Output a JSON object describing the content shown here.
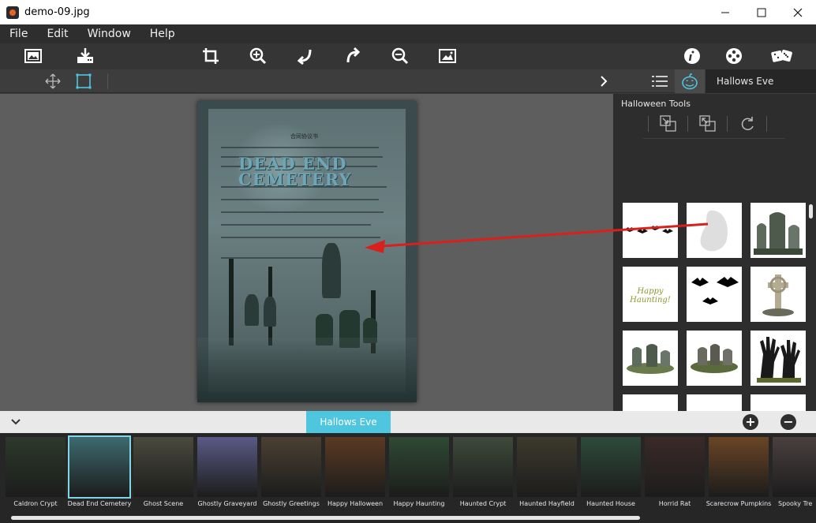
{
  "window": {
    "title": "demo-09.jpg",
    "minimize": "—",
    "maximize": "☐",
    "close": "✕"
  },
  "menu": {
    "items": [
      "File",
      "Edit",
      "Window",
      "Help"
    ]
  },
  "toolbar": {
    "left_icons": [
      "open-image-icon",
      "save-icon"
    ],
    "center_icons": [
      "crop-icon",
      "zoom-in-icon",
      "undo-icon",
      "redo-icon",
      "zoom-out-icon",
      "fit-image-icon"
    ],
    "right_icons": [
      "info-icon",
      "film-reel-icon",
      "dice-icon"
    ]
  },
  "subbar": {
    "icons": [
      "move-icon",
      "select-rect-icon"
    ],
    "expand_icon": "chevron-right-icon",
    "panel_tabs": [
      "list-icon",
      "pumpkin-icon"
    ],
    "panel_title": "Hallows Eve"
  },
  "document": {
    "title": "合同协议书",
    "overlay_text_line1": "DEAD END",
    "overlay_text_line2": "CEMETERY"
  },
  "right_panel": {
    "title": "Halloween Tools",
    "tools": [
      "bring-forward-icon",
      "send-backward-icon",
      "rotate-icon"
    ],
    "thumbnails": [
      {
        "name": "bats-line",
        "caption": ""
      },
      {
        "name": "ghost",
        "caption": ""
      },
      {
        "name": "tombstones",
        "caption": ""
      },
      {
        "name": "happy-haunting-text",
        "caption": "Happy Haunting!"
      },
      {
        "name": "bats",
        "caption": ""
      },
      {
        "name": "celtic-cross",
        "caption": ""
      },
      {
        "name": "graves-1",
        "caption": ""
      },
      {
        "name": "graves-2",
        "caption": ""
      },
      {
        "name": "zombie-hands",
        "caption": ""
      }
    ]
  },
  "strip_bar": {
    "collapse_icon": "chevron-down-icon",
    "active_tab": "Hallows Eve",
    "add_label": "+",
    "remove_label": "−"
  },
  "strip": {
    "items": [
      {
        "label": "Caldron Crypt",
        "color": "#2c3a2a"
      },
      {
        "label": "Dead End Cemetery",
        "color": "#3d6a6f"
      },
      {
        "label": "Ghost Scene",
        "color": "#4a4a3e"
      },
      {
        "label": "Ghostly Graveyard",
        "color": "#5a5a86"
      },
      {
        "label": "Ghostly Greetings",
        "color": "#4b4033"
      },
      {
        "label": "Happy Halloween",
        "color": "#5b3a22"
      },
      {
        "label": "Happy Haunting",
        "color": "#2f4a33"
      },
      {
        "label": "Haunted Crypt",
        "color": "#3e4a3b"
      },
      {
        "label": "Haunted Hayfield",
        "color": "#3d3a2c"
      },
      {
        "label": "Haunted House",
        "color": "#2e4a3a"
      },
      {
        "label": "Horrid Rat",
        "color": "#3a2a28"
      },
      {
        "label": "Scarecrow Pumpkins",
        "color": "#6a4526"
      },
      {
        "label": "Spooky Tre",
        "color": "#4a4040"
      }
    ]
  },
  "accent": "#4fc6e0",
  "arrow_color": "#d8201c"
}
